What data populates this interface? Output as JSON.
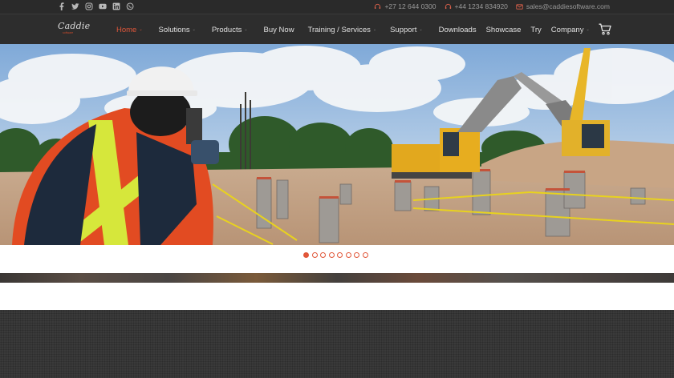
{
  "topbar": {
    "social_icons": [
      "facebook-icon",
      "twitter-icon",
      "instagram-icon",
      "youtube-icon",
      "linkedin-icon",
      "whatsapp-icon"
    ],
    "phone_za": "+27 12 644 0300",
    "phone_uk": "+44 1234 834920",
    "email": "sales@caddiesoftware.com"
  },
  "brand": {
    "logo_text": "Caddie",
    "logo_subtext": "software"
  },
  "nav": {
    "items": [
      {
        "label": "Home",
        "dropdown": true
      },
      {
        "label": "Solutions",
        "dropdown": true
      },
      {
        "label": "Products",
        "dropdown": true
      },
      {
        "label": "Buy Now",
        "dropdown": false
      },
      {
        "label": "Training / Services",
        "dropdown": true
      },
      {
        "label": "Support",
        "dropdown": true
      },
      {
        "label": "Downloads",
        "dropdown": false
      },
      {
        "label": "Showcase",
        "dropdown": false
      },
      {
        "label": "Try",
        "dropdown": false
      },
      {
        "label": "Company",
        "dropdown": true
      }
    ],
    "active_index": 0,
    "dropdown_glyph": "⌄",
    "cart_icon": "cart-icon"
  },
  "slider": {
    "slide_count": 8,
    "active_slide": 0
  },
  "colors": {
    "accent": "#e1573a",
    "topbar_bg": "#2a2a2a",
    "nav_bg": "#2d2d2d",
    "footer_bg": "#3a3a3a"
  }
}
